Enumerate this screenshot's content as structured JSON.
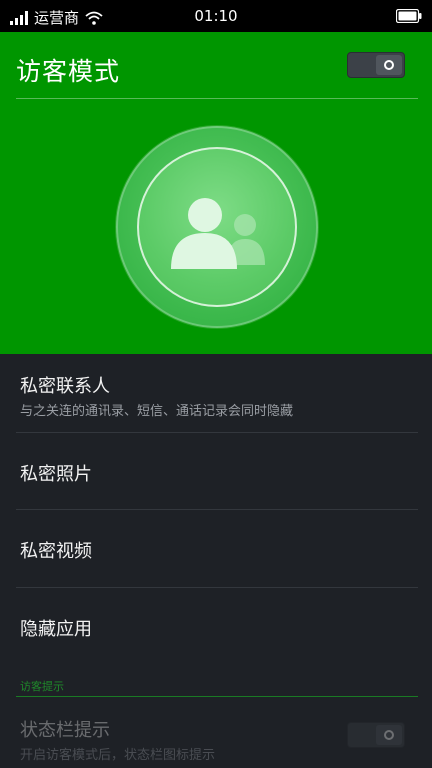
{
  "status_bar": {
    "carrier": "运营商",
    "time": "01:10",
    "signal_icon": "signal-bars-icon",
    "wifi_icon": "wifi-icon",
    "battery_icon": "battery-icon"
  },
  "header": {
    "title": "访客模式",
    "toggle_state": "off",
    "background_color": "#009600",
    "hero_icon": "guest-users-icon"
  },
  "items": [
    {
      "label": "私密联系人",
      "description": "与之关连的通讯录、短信、通话记录会同时隐藏"
    },
    {
      "label": "私密照片"
    },
    {
      "label": "私密视频"
    },
    {
      "label": "隐藏应用"
    }
  ],
  "section": {
    "title": "访客提示"
  },
  "status_hint": {
    "label": "状态栏提示",
    "description": "开启访客模式后，状态栏图标提示",
    "toggle_state": "off"
  }
}
